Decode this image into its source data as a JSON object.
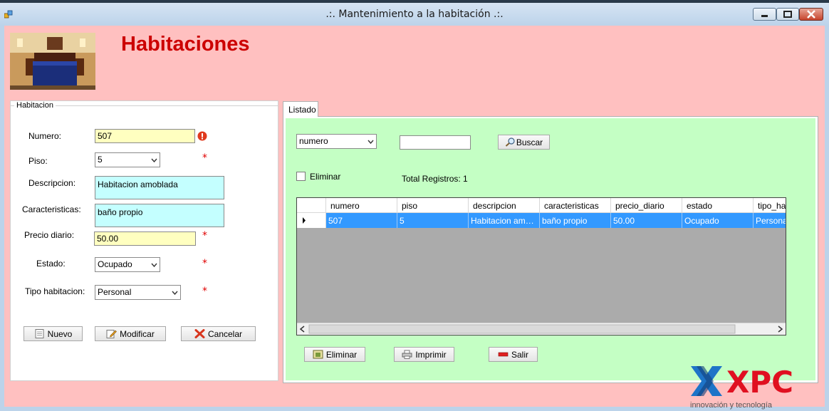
{
  "window": {
    "title": ".:. Mantenimiento a la habitación .:."
  },
  "heading": "Habitaciones",
  "form": {
    "group_title": "Habitacion",
    "numero_label": "Numero:",
    "numero_value": "507",
    "piso_label": "Piso:",
    "piso_value": "5",
    "descripcion_label": "Descripcion:",
    "descripcion_value": "Habitacion amoblada",
    "caracteristicas_label": "Caracteristicas:",
    "caracteristicas_value": "baño propio",
    "precio_label": "Precio diario:",
    "precio_value": "50.00",
    "estado_label": "Estado:",
    "estado_value": "Ocupado",
    "tipo_label": "Tipo habitacion:",
    "tipo_value": "Personal",
    "required_mark": "*",
    "error_icon": "error-circle-icon",
    "nuevo_label": "Nuevo",
    "modificar_label": "Modificar",
    "cancelar_label": "Cancelar"
  },
  "listado": {
    "tab_label": "Listado",
    "search_field_value": "numero",
    "search_text": "",
    "buscar_label": "Buscar",
    "eliminar_check_label": "Eliminar",
    "total_registros": "Total Registros: 1",
    "columns": [
      "numero",
      "piso",
      "descripcion",
      "caracteristicas",
      "precio_diario",
      "estado",
      "tipo_hab"
    ],
    "row": [
      "507",
      "5",
      "Habitacion amobl...",
      "baño propio",
      "50.00",
      "Ocupado",
      "Personal"
    ],
    "eliminar_label": "Eliminar",
    "imprimir_label": "Imprimir",
    "salir_label": "Salir"
  },
  "watermark": {
    "brand": "XPC",
    "tagline": "innovación y tecnología"
  },
  "colors": {
    "background": "#ffc0c0",
    "panel": "#c4ffc4",
    "heading": "#cc0000",
    "selection": "#3399ff",
    "required": "#e00000"
  }
}
